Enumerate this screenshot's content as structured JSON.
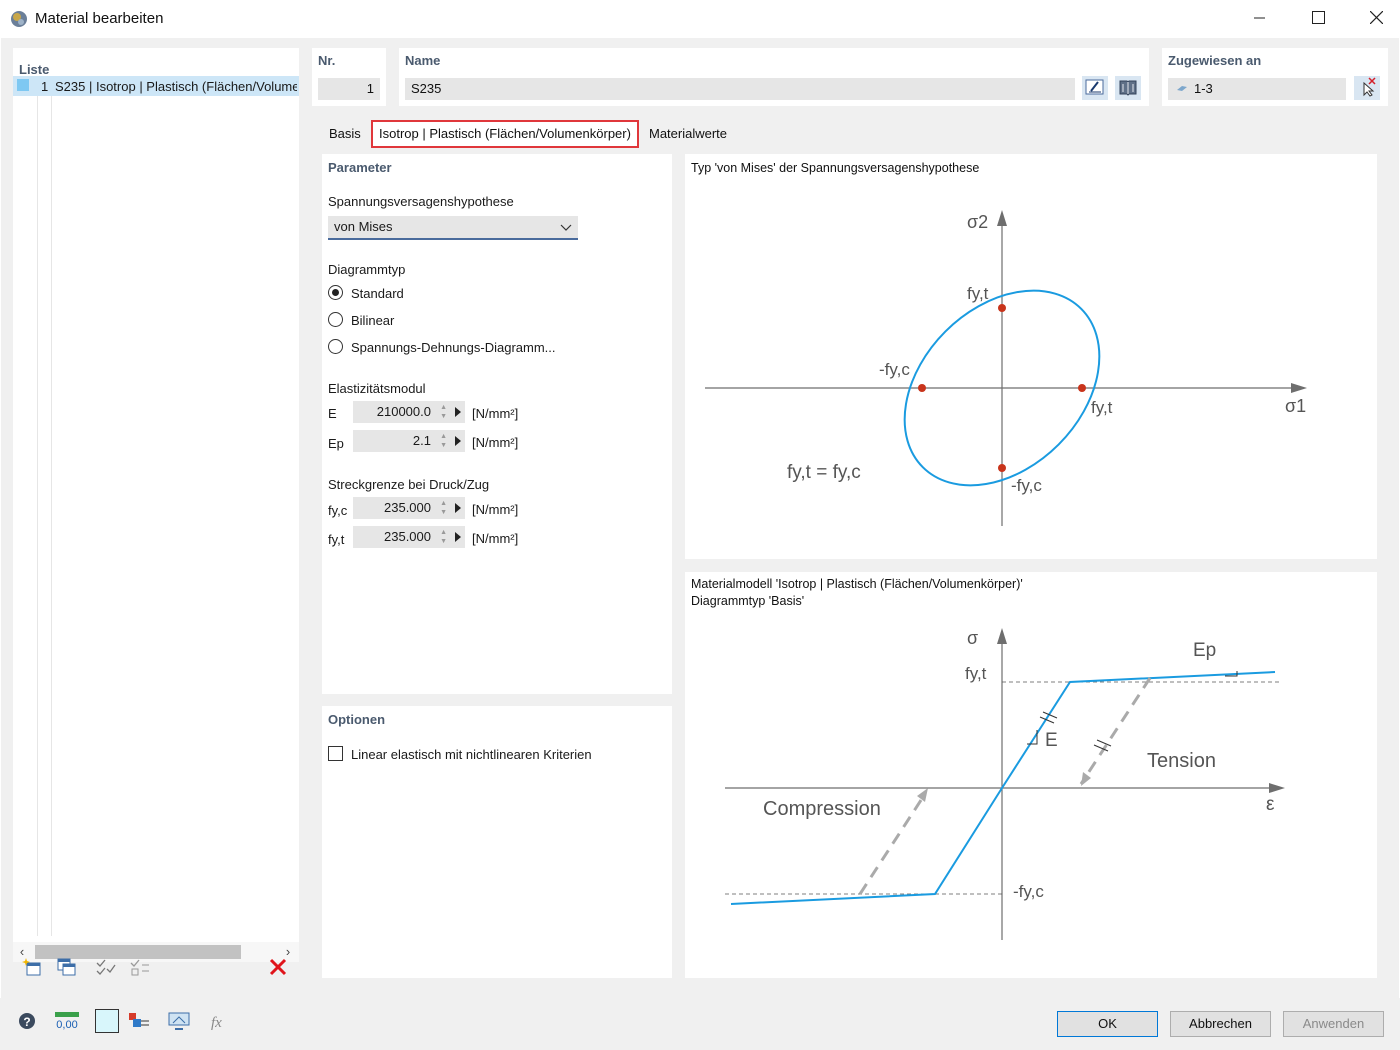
{
  "window": {
    "title": "Material bearbeiten"
  },
  "list": {
    "label": "Liste",
    "items": [
      {
        "num": "1",
        "text": "S235 | Isotrop | Plastisch (Flächen/Volumenkörper)"
      }
    ]
  },
  "header": {
    "nr_label": "Nr.",
    "nr_value": "1",
    "name_label": "Name",
    "name_value": "S235",
    "assigned_label": "Zugewiesen an",
    "assigned_value": "1-3"
  },
  "tabs": [
    "Basis",
    "Isotrop | Plastisch (Flächen/Volumenkörper)",
    "Materialwerte"
  ],
  "parameter": {
    "title": "Parameter",
    "hypothesis_label": "Spannungsversagenshypothese",
    "hypothesis_value": "von Mises",
    "diagram_type_label": "Diagrammtyp",
    "radio_options": [
      "Standard",
      "Bilinear",
      "Spannungs-Dehnungs-Diagramm..."
    ],
    "radio_selected": "Standard",
    "elasticity_label": "Elastizitätsmodul",
    "e_label": "E",
    "e_value": "210000.0",
    "ep_label": "Ep",
    "ep_value": "2.1",
    "unit": "[N/mm²]",
    "yield_label": "Streckgrenze bei Druck/Zug",
    "fyc_label": "fy,c",
    "fyc_value": "235.000",
    "fyt_label": "fy,t",
    "fyt_value": "235.000"
  },
  "options": {
    "title": "Optionen",
    "linear_elastic_label": "Linear elastisch mit nichtlinearen Kriterien",
    "linear_elastic_checked": false
  },
  "diagram_top": {
    "caption": "Typ 'von Mises' der Spannungsversagenshypothese",
    "axis_x": "σ1",
    "axis_y": "σ2",
    "label_fyt_top": "fy,t",
    "label_fyt_right": "fy,t",
    "label_fyc_left": "-fy,c",
    "label_fyc_bottom": "-fy,c",
    "equation": "fy,t = fy,c",
    "curve_color": "#1a9be0",
    "point_color": "#c8341b"
  },
  "diagram_bottom": {
    "caption_line1": "Materialmodell 'Isotrop | Plastisch (Flächen/Volumenkörper)'",
    "caption_line2": "Diagrammtyp 'Basis'",
    "axis_y": "σ",
    "axis_x": "ε",
    "label_fyt": "fy,t",
    "label_fyc": "-fy,c",
    "label_e": "E",
    "label_ep": "Ep",
    "label_tension": "Tension",
    "label_compression": "Compression"
  },
  "footer": {
    "ok": "OK",
    "cancel": "Abbrechen",
    "apply": "Anwenden"
  }
}
